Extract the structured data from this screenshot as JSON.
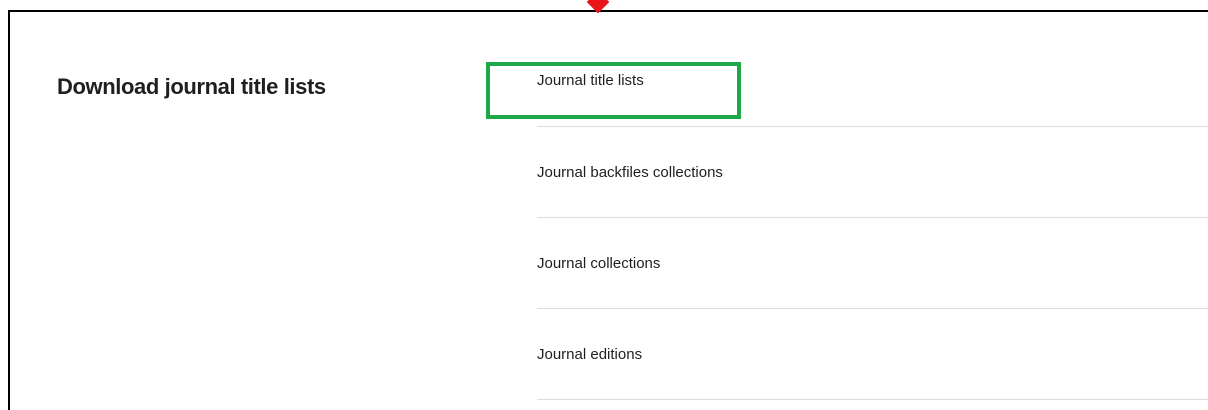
{
  "section": {
    "title": "Download journal title lists"
  },
  "links": [
    {
      "label": "Journal title lists"
    },
    {
      "label": "Journal backfiles collections"
    },
    {
      "label": "Journal collections"
    },
    {
      "label": "Journal editions"
    }
  ],
  "annotations": {
    "highlight_color": "#1fa84a",
    "pointer_color": "#e8161b",
    "pointer_icon": "red-diamond-marker"
  }
}
